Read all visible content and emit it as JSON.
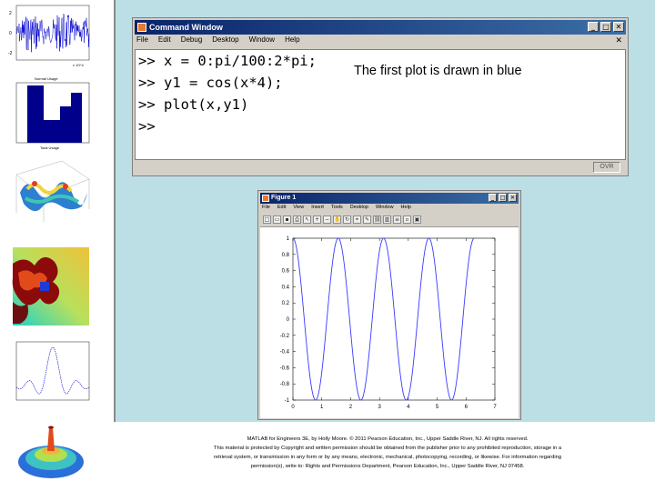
{
  "command_window": {
    "title": "Command Window",
    "menu": [
      "File",
      "Edit",
      "Debug",
      "Desktop",
      "Window",
      "Help"
    ],
    "close_glyph": "✕",
    "window_buttons": [
      "_",
      "□",
      "✕"
    ],
    "lines": [
      ">> x = 0:pi/100:2*pi;",
      ">> y1 = cos(x*4);",
      ">> plot(x,y1)",
      ">>"
    ],
    "annotation": "The first plot is drawn in blue",
    "status_indicator": "OVR"
  },
  "figure_window": {
    "title": "Figure 1",
    "menu": [
      "File",
      "Edit",
      "View",
      "Insert",
      "Tools",
      "Desktop",
      "Window",
      "Help"
    ],
    "window_buttons": [
      "_",
      "□",
      "✕"
    ],
    "toolbar_icons": [
      "new-figure-icon",
      "open-icon",
      "save-icon",
      "print-icon",
      "pointer-icon",
      "zoom-in-icon",
      "zoom-out-icon",
      "pan-icon",
      "rotate-icon",
      "data-cursor-icon",
      "brush-icon",
      "link-icon",
      "colorbar-icon",
      "legend-icon",
      "hide-tools-icon",
      "show-tools-icon"
    ],
    "toolbar_glyphs": [
      "□",
      "▭",
      "▪",
      "⎙",
      "↖",
      "+",
      "−",
      "✋",
      "↻",
      "⌖",
      "✎",
      "⛓",
      "▥",
      "≡",
      "▫",
      "▣"
    ]
  },
  "chart_data": {
    "type": "line",
    "title": "",
    "xlabel": "",
    "ylabel": "",
    "function": "y1 = cos(4*x), x = 0:pi/100:2*pi",
    "xlim": [
      0,
      7
    ],
    "ylim": [
      -1,
      1
    ],
    "x_ticks": [
      "0",
      "1",
      "2",
      "3",
      "4",
      "5",
      "6",
      "7"
    ],
    "y_ticks": [
      "-1",
      "-0.8",
      "-0.6",
      "-0.4",
      "-0.2",
      "0",
      "0.2",
      "0.4",
      "0.6",
      "0.8",
      "1"
    ],
    "series": [
      {
        "color": "#3a3aff",
        "x": [
          0,
          0.196,
          0.393,
          0.589,
          0.785,
          0.982,
          1.178,
          1.374,
          1.571,
          1.767,
          1.963,
          2.16,
          2.356,
          2.553,
          2.749,
          2.945,
          3.142,
          3.338,
          3.534,
          3.731,
          3.927,
          4.123,
          4.32,
          4.516,
          4.712,
          4.909,
          5.105,
          5.301,
          5.498,
          5.694,
          5.89,
          6.087,
          6.283
        ],
        "y": [
          1,
          0.707,
          0,
          -0.707,
          -1,
          -0.707,
          0,
          0.707,
          1,
          0.707,
          0,
          -0.707,
          -1,
          -0.707,
          0,
          0.707,
          1,
          0.707,
          0,
          -0.707,
          -1,
          -0.707,
          0,
          0.707,
          1,
          0.707,
          0,
          -0.707,
          -1,
          -0.707,
          0,
          0.707,
          1
        ]
      }
    ],
    "grid": false
  },
  "thumbnails": {
    "signal_labels": [
      "2",
      "0",
      "-2"
    ],
    "bar_labels": [
      "Normal Usage",
      "Total Usage"
    ],
    "footer_note": "x 10^4"
  },
  "footer": {
    "line1": "MATLAB for Engineers 3E, by Holly Moore. © 2011 Pearson Education, Inc., Upper Saddle River, NJ. All rights reserved.",
    "line2": "This material is protected by Copyright and written permission should be obtained from the publisher prior to any prohibited reproduction, storage in a",
    "line3": "retrieval system, or transmission in any form or by any means, electronic, mechanical, photocopying, recording, or likewise. For information regarding",
    "line4": "permission(s), write to: Rights and Permissions Department, Pearson Education, Inc., Upper Saddle River, NJ 07458."
  },
  "colors": {
    "slide_background": "#bcdfe5",
    "titlebar_start": "#0a246a",
    "titlebar_end": "#3b6ea5",
    "plot_line": "#3a3aff"
  }
}
